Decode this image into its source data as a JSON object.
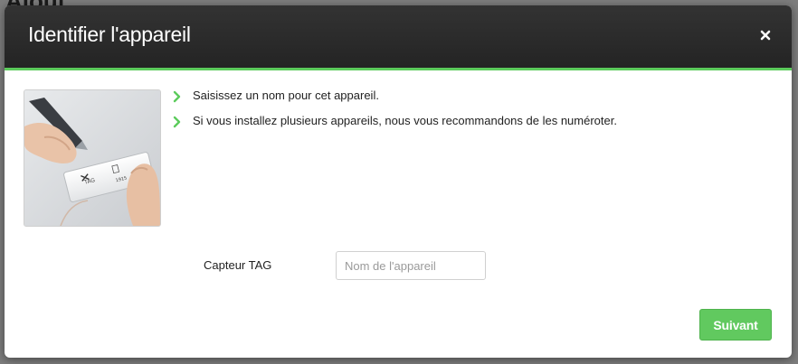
{
  "background": {
    "partial_title": "Ajout..."
  },
  "dialog": {
    "title": "Identifier l'appareil",
    "close_label": "×",
    "image": {
      "icon": "device-tag-photo",
      "tag_texts": [
        "TAG",
        "1915"
      ]
    },
    "instructions": [
      "Saisissez un nom pour cet appareil.",
      "Si vous installez plusieurs appareils, nous vous recommandons de les numéroter."
    ],
    "field": {
      "label": "Capteur TAG",
      "value": "",
      "placeholder": "Nom de l'appareil"
    },
    "next_button_label": "Suivant"
  },
  "colors": {
    "header_bg": "#2b2b2b",
    "accent": "#5ccb5c",
    "button_bg": "#61c95f",
    "text": "#222222"
  }
}
